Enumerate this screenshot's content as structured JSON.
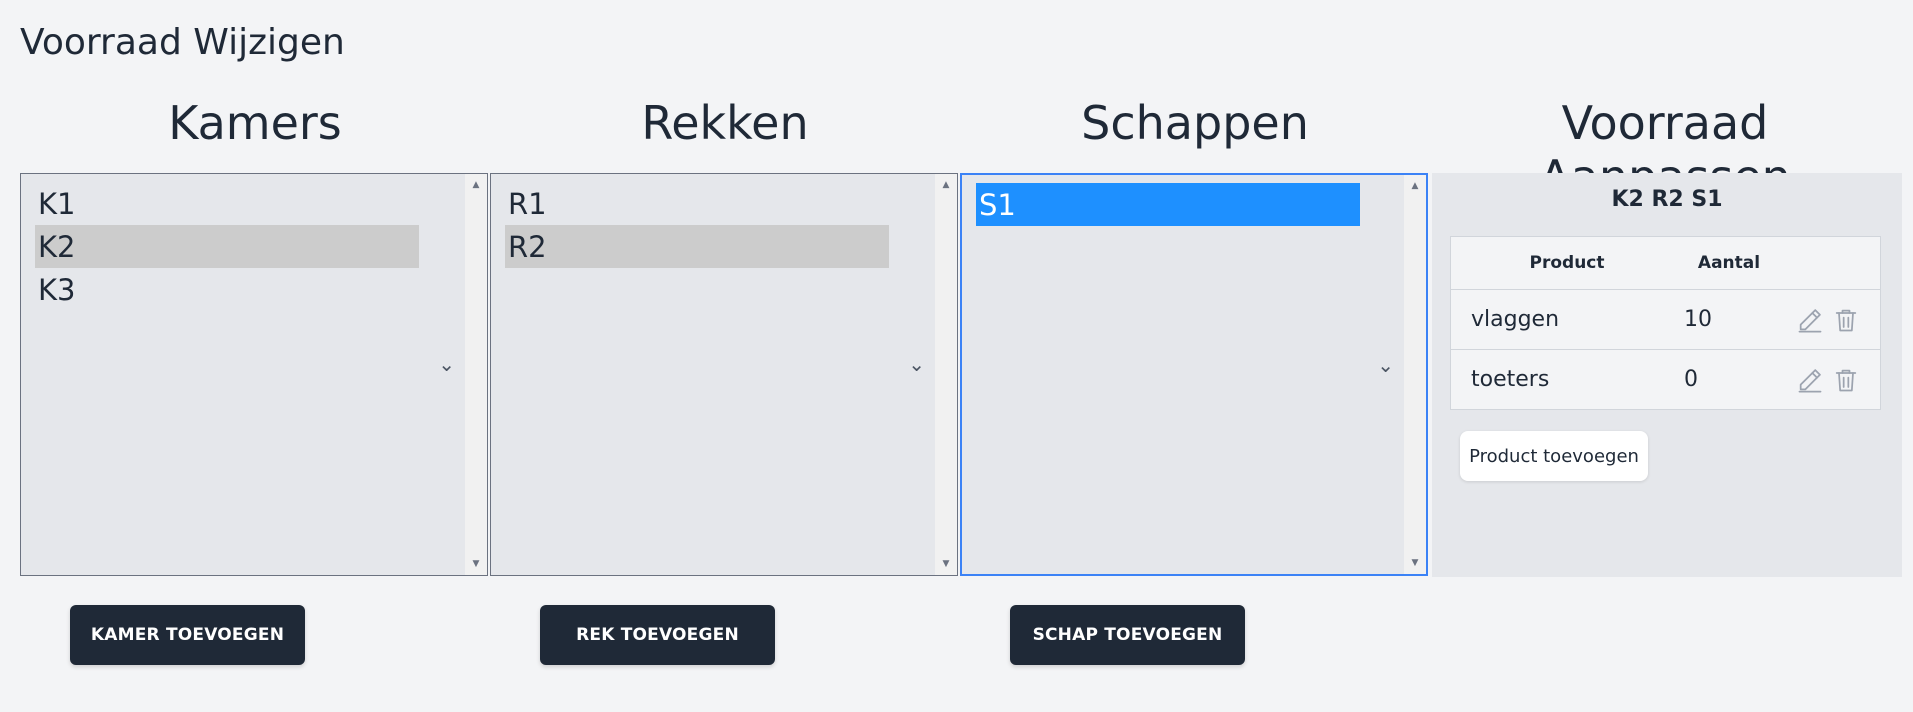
{
  "page": {
    "title": "Voorraad Wijzigen"
  },
  "columns": {
    "rooms": {
      "heading": "Kamers",
      "items": [
        {
          "label": "K1",
          "state": "none"
        },
        {
          "label": "K2",
          "state": "selected"
        },
        {
          "label": "K3",
          "state": "none"
        }
      ],
      "button_label": "KAMER TOEVOEGEN"
    },
    "racks": {
      "heading": "Rekken",
      "items": [
        {
          "label": "R1",
          "state": "none"
        },
        {
          "label": "R2",
          "state": "selected"
        }
      ],
      "button_label": "REK TOEVOEGEN"
    },
    "shelves": {
      "heading": "Schappen",
      "items": [
        {
          "label": "S1",
          "state": "active"
        }
      ],
      "button_label": "SCHAP TOEVOEGEN"
    }
  },
  "stock": {
    "heading": "Voorraad Aanpassen",
    "location": "K2 R2 S1",
    "table": {
      "headers": [
        "Product",
        "Aantal"
      ],
      "rows": [
        {
          "product": "vlaggen",
          "amount": "10"
        },
        {
          "product": "toeters",
          "amount": "0"
        }
      ]
    },
    "add_button_label": "Product toevoegen"
  },
  "icons": {
    "edit": "pencil-icon",
    "delete": "trash-icon",
    "scroll_up": "triangle-up-icon",
    "scroll_down": "triangle-down-icon",
    "dropdown": "chevron-down-icon"
  },
  "colors": {
    "background": "#f3f4f6",
    "panel": "#e5e7eb",
    "selected_gray": "#cccccc",
    "selected_blue": "#1e90ff",
    "focus_border": "#3b82f6",
    "button_dark": "#1f2937"
  }
}
